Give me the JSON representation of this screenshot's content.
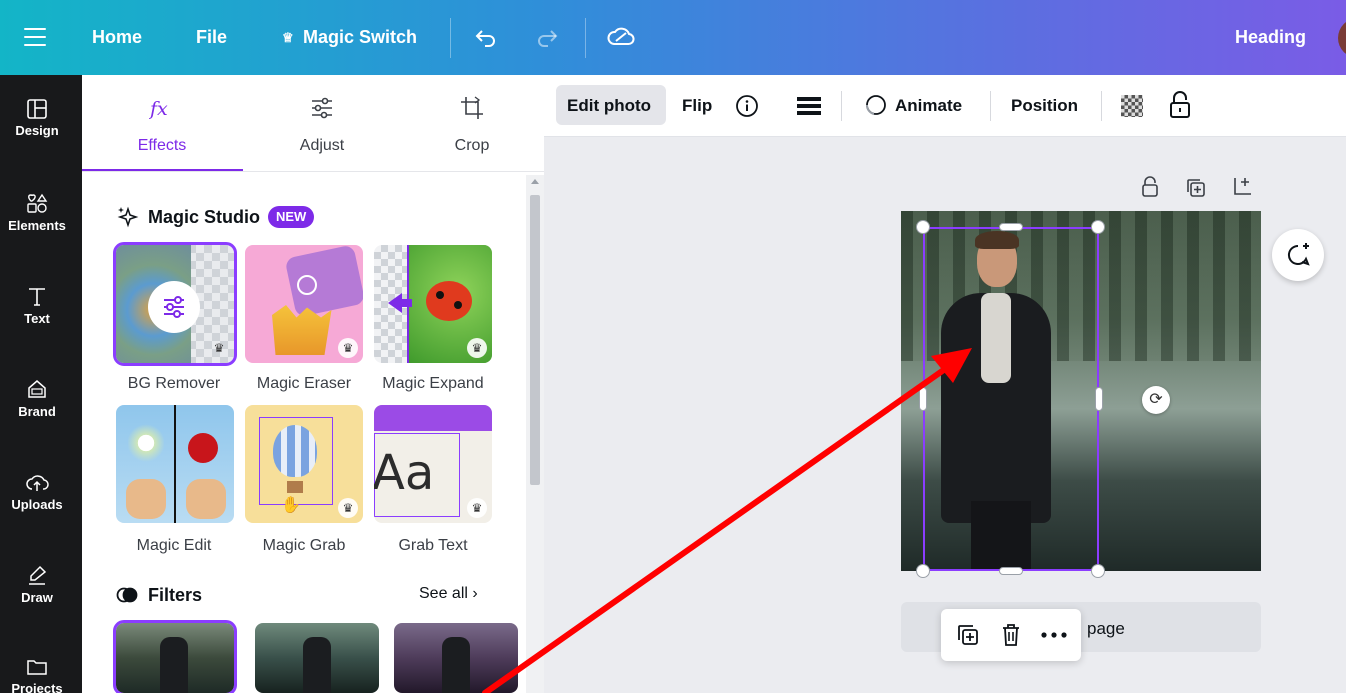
{
  "topbar": {
    "home": "Home",
    "file": "File",
    "magic_switch": "Magic Switch",
    "heading": "Heading",
    "menu_icon": "hamburger-icon",
    "undo_icon": "undo-icon",
    "redo_icon": "redo-icon",
    "sync_icon": "cloud-check-icon"
  },
  "rail": {
    "items": [
      {
        "label": "Design",
        "icon": "layout-icon"
      },
      {
        "label": "Elements",
        "icon": "shapes-icon"
      },
      {
        "label": "Text",
        "icon": "text-icon"
      },
      {
        "label": "Brand",
        "icon": "brand-icon"
      },
      {
        "label": "Uploads",
        "icon": "cloud-upload-icon"
      },
      {
        "label": "Draw",
        "icon": "draw-icon"
      },
      {
        "label": "Projects",
        "icon": "folder-icon"
      }
    ]
  },
  "panel": {
    "tabs": [
      {
        "label": "Effects",
        "icon": "fx-icon"
      },
      {
        "label": "Adjust",
        "icon": "sliders-icon"
      },
      {
        "label": "Crop",
        "icon": "crop-icon"
      }
    ],
    "magic_studio": {
      "title": "Magic Studio",
      "badge": "NEW",
      "tools": [
        {
          "label": "BG Remover"
        },
        {
          "label": "Magic Eraser"
        },
        {
          "label": "Magic Expand"
        },
        {
          "label": "Magic Edit"
        },
        {
          "label": "Magic Grab"
        },
        {
          "label": "Grab Text"
        }
      ]
    },
    "filters": {
      "title": "Filters",
      "see_all": "See all"
    }
  },
  "canvas_toolbar": {
    "edit_photo": "Edit photo",
    "flip": "Flip",
    "animate": "Animate",
    "position": "Position"
  },
  "canvas": {
    "add_page": "page"
  },
  "colors": {
    "accent": "#8b3dff",
    "arrow": "#ff0000",
    "rail_bg": "#18191b"
  }
}
